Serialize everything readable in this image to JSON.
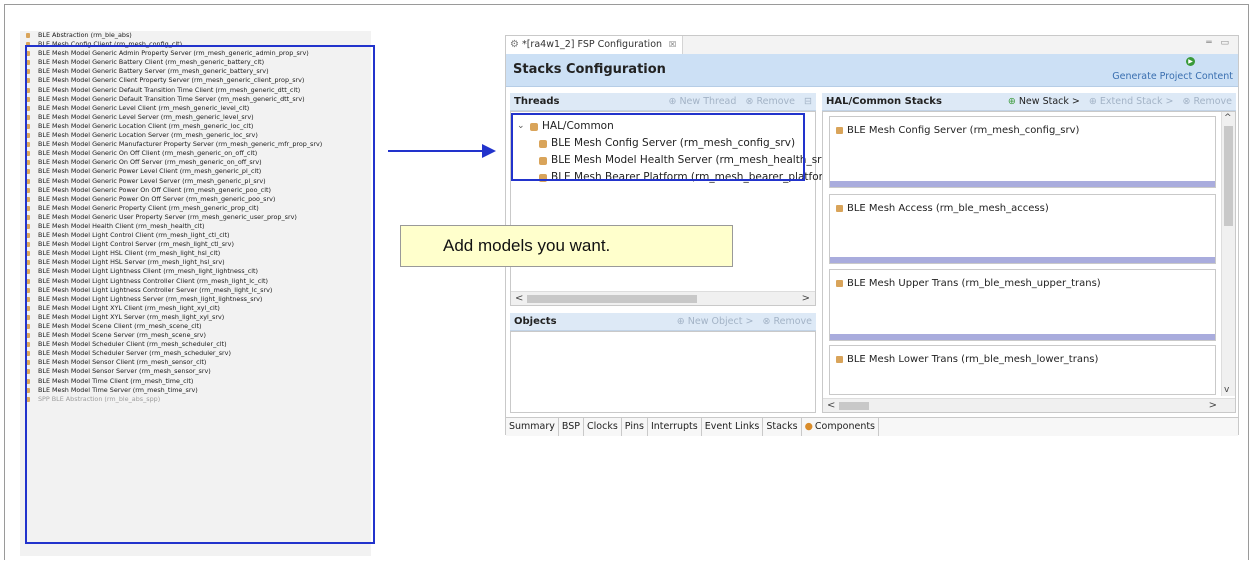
{
  "left_list": {
    "items": [
      {
        "label": "BLE Abstraction (rm_ble_abs)",
        "dim": false
      },
      {
        "label": "BLE Mesh Config Client (rm_mesh_config_clt)",
        "dim": false
      },
      {
        "label": "BLE Mesh Model Generic Admin Property Server (rm_mesh_generic_admin_prop_srv)",
        "dim": false
      },
      {
        "label": "BLE Mesh Model Generic Battery Client (rm_mesh_generic_battery_clt)",
        "dim": false
      },
      {
        "label": "BLE Mesh Model Generic Battery Server (rm_mesh_generic_battery_srv)",
        "dim": false
      },
      {
        "label": "BLE Mesh Model Generic Client Property Server (rm_mesh_generic_client_prop_srv)",
        "dim": false
      },
      {
        "label": "BLE Mesh Model Generic Default Transition Time Client (rm_mesh_generic_dtt_clt)",
        "dim": false
      },
      {
        "label": "BLE Mesh Model Generic Default Transition Time Server (rm_mesh_generic_dtt_srv)",
        "dim": false
      },
      {
        "label": "BLE Mesh Model Generic Level Client (rm_mesh_generic_level_clt)",
        "dim": false
      },
      {
        "label": "BLE Mesh Model Generic Level Server (rm_mesh_generic_level_srv)",
        "dim": false
      },
      {
        "label": "BLE Mesh Model Generic Location Client (rm_mesh_generic_loc_clt)",
        "dim": false
      },
      {
        "label": "BLE Mesh Model Generic Location Server (rm_mesh_generic_loc_srv)",
        "dim": false
      },
      {
        "label": "BLE Mesh Model Generic Manufacturer Property Server (rm_mesh_generic_mfr_prop_srv)",
        "dim": false
      },
      {
        "label": "BLE Mesh Model Generic On Off Client (rm_mesh_generic_on_off_clt)",
        "dim": false
      },
      {
        "label": "BLE Mesh Model Generic On Off Server (rm_mesh_generic_on_off_srv)",
        "dim": false
      },
      {
        "label": "BLE Mesh Model Generic Power Level Client (rm_mesh_generic_pl_clt)",
        "dim": false
      },
      {
        "label": "BLE Mesh Model Generic Power Level Server (rm_mesh_generic_pl_srv)",
        "dim": false
      },
      {
        "label": "BLE Mesh Model Generic Power On Off Client (rm_mesh_generic_poo_clt)",
        "dim": false
      },
      {
        "label": "BLE Mesh Model Generic Power On Off Server (rm_mesh_generic_poo_srv)",
        "dim": false
      },
      {
        "label": "BLE Mesh Model Generic Property Client (rm_mesh_generic_prop_clt)",
        "dim": false
      },
      {
        "label": "BLE Mesh Model Generic User Property Server (rm_mesh_generic_user_prop_srv)",
        "dim": false
      },
      {
        "label": "BLE Mesh Model Health Client (rm_mesh_health_clt)",
        "dim": false
      },
      {
        "label": "BLE Mesh Model Light Control Client (rm_mesh_light_ctl_clt)",
        "dim": false
      },
      {
        "label": "BLE Mesh Model Light Control Server (rm_mesh_light_ctl_srv)",
        "dim": false
      },
      {
        "label": "BLE Mesh Model Light HSL Client (rm_mesh_light_hsl_clt)",
        "dim": false
      },
      {
        "label": "BLE Mesh Model Light HSL Server (rm_mesh_light_hsl_srv)",
        "dim": false
      },
      {
        "label": "BLE Mesh Model Light Lightness Client (rm_mesh_light_lightness_clt)",
        "dim": false
      },
      {
        "label": "BLE Mesh Model Light Lightness Controller Client (rm_mesh_light_lc_clt)",
        "dim": false
      },
      {
        "label": "BLE Mesh Model Light Lightness Controller Server (rm_mesh_light_lc_srv)",
        "dim": false
      },
      {
        "label": "BLE Mesh Model Light Lightness Server (rm_mesh_light_lightness_srv)",
        "dim": false
      },
      {
        "label": "BLE Mesh Model Light XYL Client (rm_mesh_light_xyl_clt)",
        "dim": false
      },
      {
        "label": "BLE Mesh Model Light XYL Server (rm_mesh_light_xyl_srv)",
        "dim": false
      },
      {
        "label": "BLE Mesh Model Scene Client (rm_mesh_scene_clt)",
        "dim": false
      },
      {
        "label": "BLE Mesh Model Scene Server (rm_mesh_scene_srv)",
        "dim": false
      },
      {
        "label": "BLE Mesh Model Scheduler Client (rm_mesh_scheduler_clt)",
        "dim": false
      },
      {
        "label": "BLE Mesh Model Scheduler Server (rm_mesh_scheduler_srv)",
        "dim": false
      },
      {
        "label": "BLE Mesh Model Sensor Client (rm_mesh_sensor_clt)",
        "dim": false
      },
      {
        "label": "BLE Mesh Model Sensor Server (rm_mesh_sensor_srv)",
        "dim": false
      },
      {
        "label": "BLE Mesh Model Time Client (rm_mesh_time_clt)",
        "dim": false
      },
      {
        "label": "BLE Mesh Model Time Server (rm_mesh_time_srv)",
        "dim": false
      },
      {
        "label": "SPP BLE Abstraction (rm_ble_abs_spp)",
        "dim": true
      }
    ]
  },
  "callout": {
    "text": "Add models you want."
  },
  "fsp": {
    "tab_label": "*[ra4w1_2] FSP Configuration",
    "tab_close": "☒",
    "window_controls": "═ ▭",
    "header_title": "Stacks Configuration",
    "generate_label": "Generate Project Content",
    "threads": {
      "title": "Threads",
      "new_thread": "New Thread",
      "remove": "Remove",
      "root_label": "HAL/Common",
      "children": [
        "BLE Mesh Config Server (rm_mesh_config_srv)",
        "BLE Mesh Model Health Server (rm_mesh_health_srv)",
        "BLE Mesh Bearer Platform (rm_mesh_bearer_platform)"
      ]
    },
    "objects": {
      "title": "Objects",
      "new_object": "New Object >",
      "remove": "Remove"
    },
    "hal": {
      "title": "HAL/Common Stacks",
      "new_stack": "New Stack >",
      "extend_stack": "Extend Stack >",
      "remove": "Remove",
      "stacks": [
        "BLE Mesh Config Server (rm_mesh_config_srv)",
        "BLE Mesh Access (rm_ble_mesh_access)",
        "BLE Mesh Upper Trans (rm_ble_mesh_upper_trans)",
        "BLE Mesh Lower Trans (rm_ble_mesh_lower_trans)"
      ]
    },
    "bottom_tabs": [
      "Summary",
      "BSP",
      "Clocks",
      "Pins",
      "Interrupts",
      "Event Links",
      "Stacks",
      "Components"
    ]
  },
  "colors": {
    "highlight_border": "#2233cc",
    "header_bg": "#cce0f5",
    "callout_bg": "#ffffcc"
  }
}
